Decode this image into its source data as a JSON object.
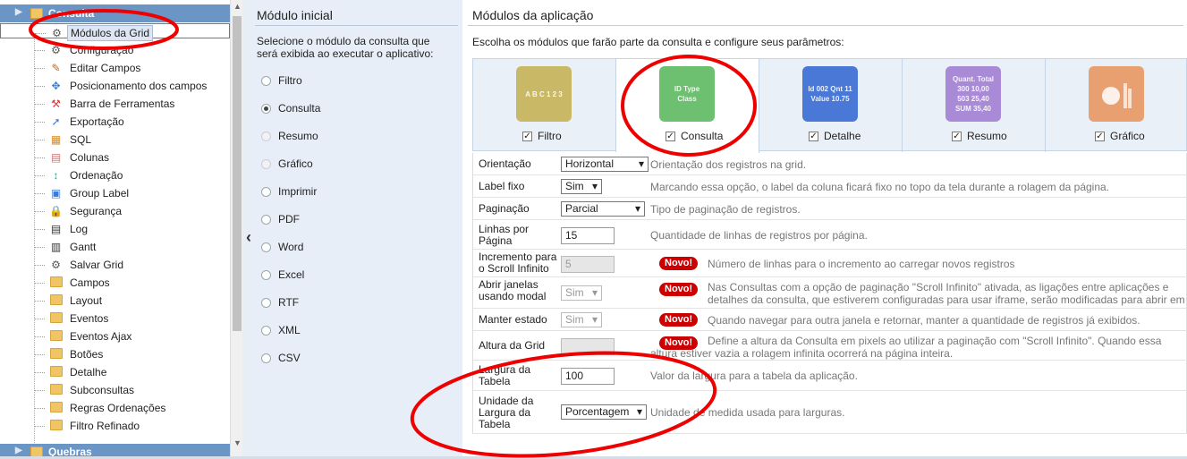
{
  "sidebar": {
    "root": "Consulta",
    "bottom": "Quebras",
    "items": [
      {
        "label": "Módulos da Grid",
        "icon": "gear-icon",
        "selected": true
      },
      {
        "label": "Configuração",
        "icon": "gear-icon"
      },
      {
        "label": "Editar Campos",
        "icon": "pencil-icon"
      },
      {
        "label": "Posicionamento dos campos",
        "icon": "move-icon"
      },
      {
        "label": "Barra de Ferramentas",
        "icon": "toolbar-icon"
      },
      {
        "label": "Exportação",
        "icon": "export-icon"
      },
      {
        "label": "SQL",
        "icon": "sql-icon"
      },
      {
        "label": "Colunas",
        "icon": "columns-icon"
      },
      {
        "label": "Ordenação",
        "icon": "sort-icon"
      },
      {
        "label": "Group Label",
        "icon": "group-label-icon"
      },
      {
        "label": "Segurança",
        "icon": "lock-icon"
      },
      {
        "label": "Log",
        "icon": "log-icon"
      },
      {
        "label": "Gantt",
        "icon": "gantt-icon"
      },
      {
        "label": "Salvar Grid",
        "icon": "gear-icon"
      },
      {
        "label": "Campos",
        "icon": "folder-icon"
      },
      {
        "label": "Layout",
        "icon": "folder-icon"
      },
      {
        "label": "Eventos",
        "icon": "folder-icon"
      },
      {
        "label": "Eventos Ajax",
        "icon": "folder-icon"
      },
      {
        "label": "Botões",
        "icon": "folder-icon"
      },
      {
        "label": "Detalhe",
        "icon": "folder-icon"
      },
      {
        "label": "Subconsultas",
        "icon": "folder-icon"
      },
      {
        "label": "Regras Ordenações",
        "icon": "folder-icon"
      },
      {
        "label": "Filtro Refinado",
        "icon": "folder-icon"
      }
    ]
  },
  "initial_module": {
    "title": "Módulo inicial",
    "description": "Selecione o módulo da consulta que será exibida ao executar o aplicativo:",
    "options": [
      {
        "label": "Filtro",
        "state": "enabled"
      },
      {
        "label": "Consulta",
        "state": "checked"
      },
      {
        "label": "Resumo",
        "state": "disabled"
      },
      {
        "label": "Gráfico",
        "state": "disabled"
      },
      {
        "label": "Imprimir",
        "state": "enabled"
      },
      {
        "label": "PDF",
        "state": "enabled"
      },
      {
        "label": "Word",
        "state": "enabled"
      },
      {
        "label": "Excel",
        "state": "enabled"
      },
      {
        "label": "RTF",
        "state": "enabled"
      },
      {
        "label": "XML",
        "state": "enabled"
      },
      {
        "label": "CSV",
        "state": "enabled"
      }
    ]
  },
  "app_modules": {
    "title": "Módulos da aplicação",
    "description": "Escolha os módulos que farão parte da consulta e configure seus parâmetros:",
    "tabs": [
      {
        "label": "Filtro",
        "checked": true,
        "color": "#c9b865",
        "icon": "filter-module-icon"
      },
      {
        "label": "Consulta",
        "checked": true,
        "color": "#6cc070",
        "icon": "grid-module-icon",
        "active": true
      },
      {
        "label": "Detalhe",
        "checked": true,
        "color": "#4a78d6",
        "icon": "detail-module-icon"
      },
      {
        "label": "Resumo",
        "checked": true,
        "color": "#a98ad6",
        "icon": "summary-module-icon"
      },
      {
        "label": "Gráfico",
        "checked": true,
        "color": "#e8a070",
        "icon": "chart-module-icon"
      }
    ],
    "thumb_text": {
      "filter": "A B C 1 2 3",
      "grid": "ID Type Class",
      "detail": "Id 002 Qnt 11 Value 10.75",
      "summary": "Quant. Total 300 10,00 503 25,40 SUM 35,40"
    },
    "badge": "Novo!",
    "rows": [
      {
        "label": "Orientação",
        "control": "select",
        "value": "Horizontal",
        "hint": "Orientação dos registros na grid."
      },
      {
        "label": "Label fixo",
        "control": "select",
        "value": "Sim",
        "hint": "Marcando essa opção, o label da coluna ficará fixo no topo da tela durante a rolagem da página."
      },
      {
        "label": "Paginação",
        "control": "select",
        "value": "Parcial",
        "hint": "Tipo de paginação de registros."
      },
      {
        "label": "Linhas por Página",
        "control": "text",
        "value": "15",
        "hint": "Quantidade de linhas de registros por página."
      },
      {
        "label": "Incremento para o Scroll Infinito",
        "control": "text-disabled",
        "value": "5",
        "badge": true,
        "hint": "Número de linhas para o incremento ao carregar novos registros"
      },
      {
        "label": "Abrir janelas usando modal",
        "control": "select-disabled",
        "value": "Sim",
        "badge": true,
        "hint": "Nas Consultas com a opção de paginação \"Scroll Infinito\" ativada, as ligações entre aplicações e",
        "hint2": "detalhes da consulta, que estiverem configuradas para usar iframe, serão modificadas para abrir em modal."
      },
      {
        "label": "Manter estado",
        "control": "select-disabled",
        "value": "Sim",
        "badge": true,
        "hint": "Quando navegar para outra janela e retornar, manter a quantidade de registros já exibidos."
      },
      {
        "label": "Altura da Grid",
        "control": "text-disabled",
        "value": "",
        "badge": true,
        "hint": "Define a altura da Consulta em pixels ao utilizar a paginação com \"Scroll Infinito\". Quando essa",
        "hint2": "altura estiver vazia a rolagem infinita ocorrerá na página inteira."
      },
      {
        "label": "Largura da Tabela",
        "control": "text",
        "value": "100",
        "hint": "Valor da largura para a tabela da aplicação."
      },
      {
        "label": "Unidade da Largura da Tabela",
        "control": "select",
        "value": "Porcentagem",
        "hint": "Unidade de medida usada para larguras."
      }
    ]
  }
}
